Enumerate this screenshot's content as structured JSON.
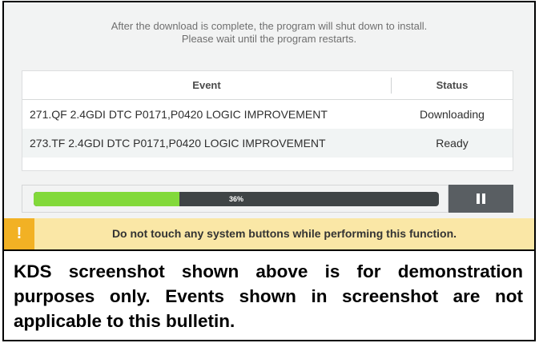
{
  "notice": {
    "line1": "After the download is complete, the program will shut down to install.",
    "line2": "Please wait until the program restarts."
  },
  "table": {
    "headers": {
      "event": "Event",
      "status": "Status"
    },
    "rows": [
      {
        "event": "271.QF 2.4GDI DTC P0171,P0420 LOGIC IMPROVEMENT",
        "status": "Downloading"
      },
      {
        "event": "273.TF 2.4GDI DTC P0171,P0420 LOGIC IMPROVEMENT",
        "status": "Ready"
      }
    ]
  },
  "progress": {
    "value": 0.36,
    "label": "36%",
    "fill_color": "#82d93a",
    "track_color": "#3f4446"
  },
  "pause_button": {
    "icon": "pause-icon"
  },
  "warning": {
    "icon_glyph": "!",
    "icon": "exclamation-icon",
    "text": "Do not touch any system buttons while performing this function.",
    "background_color": "#fae7a6",
    "icon_color": "#f2b124"
  },
  "disclaimer": {
    "text": "KDS screenshot shown above is for demonstration purposes only. Events shown in screenshot are not applicable to this bulletin."
  }
}
